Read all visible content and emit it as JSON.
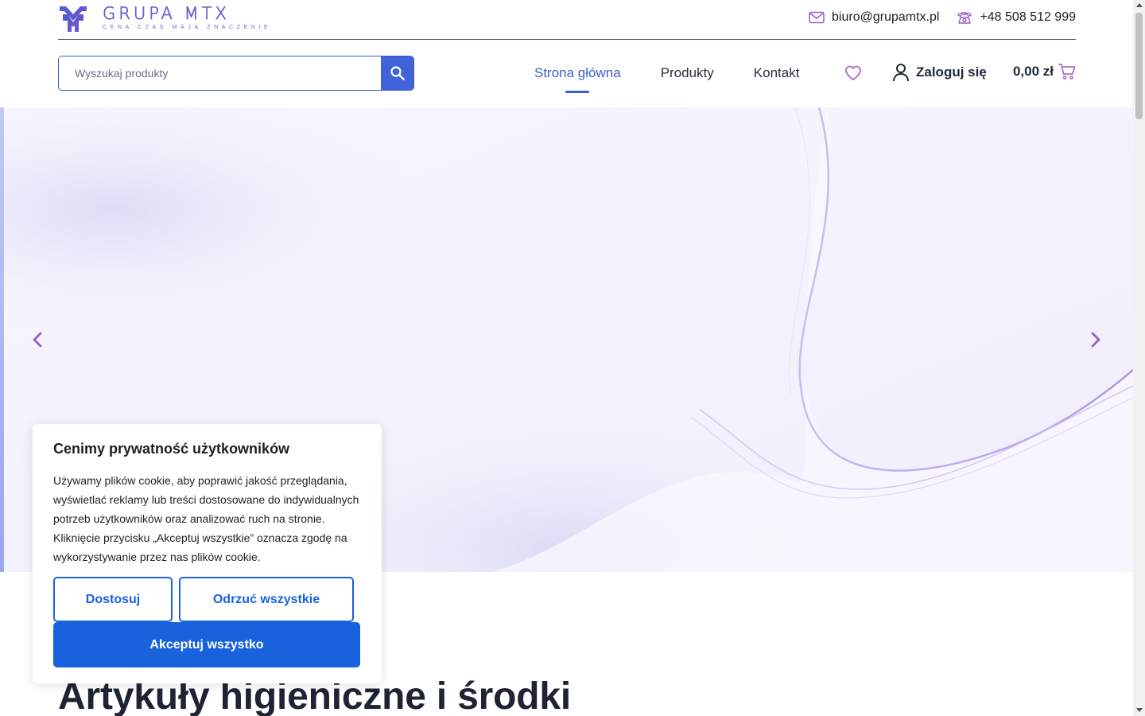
{
  "brand": {
    "name": "GRUPA MTX",
    "tagline": "CENA  CZAS MAJĄ ZNACZENIE"
  },
  "contact": {
    "email": "biuro@grupamtx.pl",
    "phone": "+48 508 512 999"
  },
  "search": {
    "placeholder": "Wyszukaj produkty"
  },
  "nav": {
    "items": [
      {
        "label": "Strona główna",
        "active": true
      },
      {
        "label": "Produkty",
        "active": false
      },
      {
        "label": "Kontakt",
        "active": false
      }
    ]
  },
  "account": {
    "login_label": "Zaloguj się"
  },
  "cart": {
    "total": "0,00 zł"
  },
  "hero": {
    "icons": {
      "prev": "chevron-left-icon",
      "next": "chevron-right-icon"
    }
  },
  "section": {
    "title": "Artykuły higieniczne i środki"
  },
  "cookie": {
    "title": "Cenimy prywatność użytkowników",
    "text": "Używamy plików cookie, aby poprawić jakość przeglądania, wyświetlać reklamy lub treści dostosowane do indywidualnych potrzeb użytkowników oraz analizować ruch na stronie. Kliknięcie przycisku „Akceptuj wszystkie” oznacza zgodę na wykorzystywanie przez nas plików cookie.",
    "customize_label": "Dostosuj",
    "reject_label": "Odrzuć wszystkie",
    "accept_label": "Akceptuj wszystko"
  },
  "colors": {
    "accent": "#3c5fc9",
    "cookie_button": "#1863dc",
    "brand_purple": "#9b5cc4"
  }
}
